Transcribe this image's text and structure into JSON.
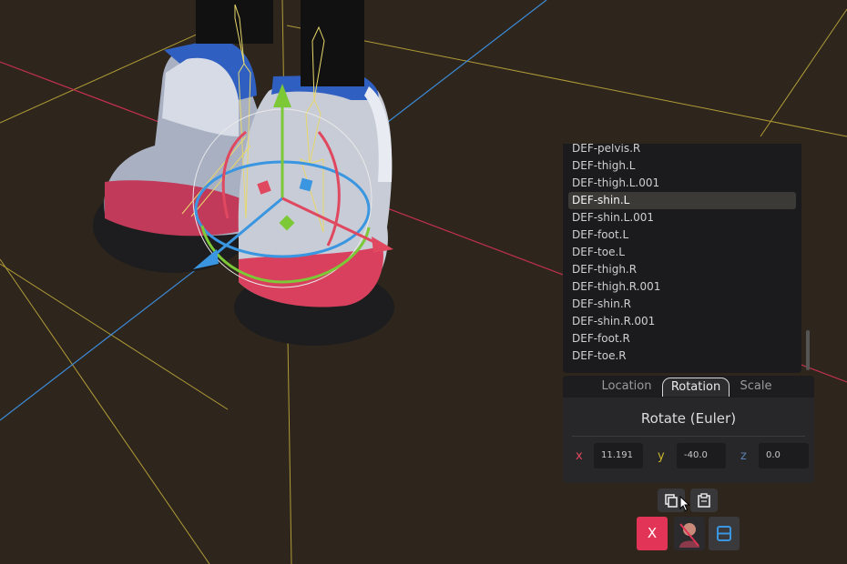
{
  "bone_list": {
    "items": [
      "DEF-pelvis.R",
      "DEF-thigh.L",
      "DEF-thigh.L.001",
      "DEF-shin.L",
      "DEF-shin.L.001",
      "DEF-foot.L",
      "DEF-toe.L",
      "DEF-thigh.R",
      "DEF-thigh.R.001",
      "DEF-shin.R",
      "DEF-shin.R.001",
      "DEF-foot.R",
      "DEF-toe.R"
    ],
    "selected": "DEF-shin.L"
  },
  "transform_panel": {
    "tabs": [
      "Location",
      "Rotation",
      "Scale"
    ],
    "active_tab": "Rotation",
    "title": "Rotate (Euler)",
    "fields": [
      {
        "axis": "x",
        "value": "11.191",
        "color": "#e0485f"
      },
      {
        "axis": "y",
        "value": "-40.0",
        "color": "#c9b62c"
      },
      {
        "axis": "z",
        "value": "0.0",
        "color": "#5b7fb0"
      }
    ]
  },
  "toolbar": {
    "copy_icon": "copy-icon",
    "paste_icon": "clipboard-icon",
    "close_label": "X",
    "avatar_icon": "avatar-icon",
    "layout_icon": "panel-layout-icon"
  },
  "colors": {
    "accent": "#e23456",
    "x_axis": "#e0485f",
    "y_axis": "#c9b62c",
    "z_axis": "#5b7fb0",
    "gizmo_blue": "#3a96e0",
    "gizmo_green": "#7cc836",
    "selection_bg": "#3c3a36"
  }
}
